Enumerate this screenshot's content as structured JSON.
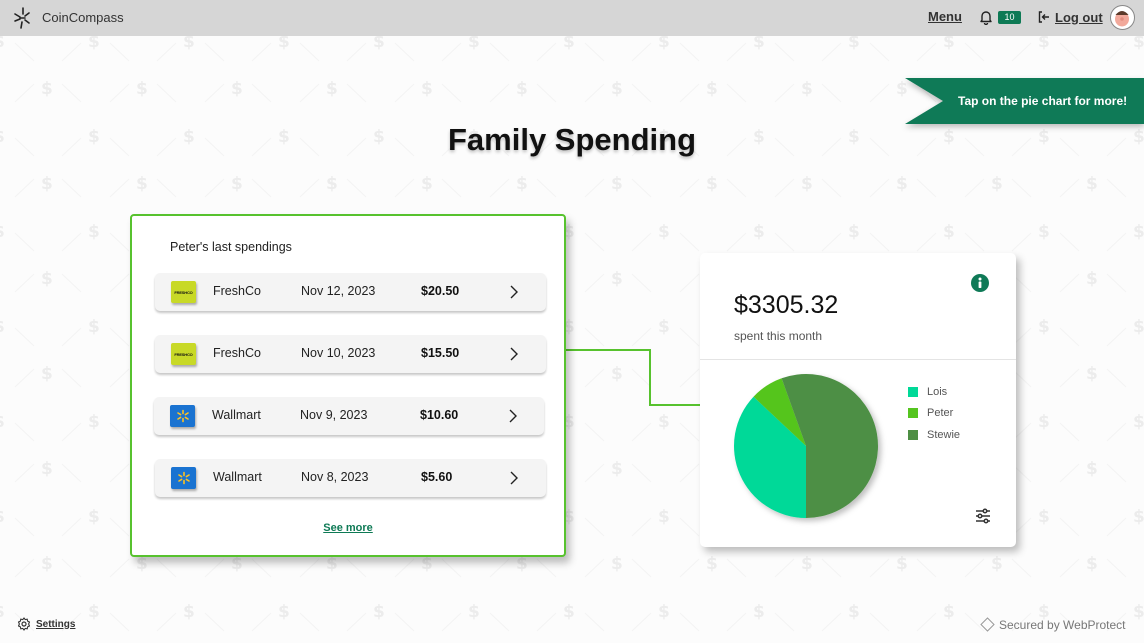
{
  "header": {
    "app_name": "CoinCompass",
    "menu_label": "Menu",
    "notification_count": "10",
    "logout_label": "Log out",
    "icons": {
      "logo": "compass-logo-icon",
      "bell": "bell-icon",
      "logout": "logout-icon",
      "avatar": "user-avatar"
    }
  },
  "banner": {
    "text": "Tap on the pie chart for more!",
    "color": "#0f7a57"
  },
  "page_title": "Family Spending",
  "spendings": {
    "title": "Peter's last spendings",
    "transactions": [
      {
        "merchant": "FreshCo",
        "logo": "FRESHCO",
        "logo_type": "freshco",
        "date": "Nov 12, 2023",
        "amount": "$20.50"
      },
      {
        "merchant": "FreshCo",
        "logo": "FRESHCO",
        "logo_type": "freshco",
        "date": "Nov 10, 2023",
        "amount": "$15.50"
      },
      {
        "merchant": "Wallmart",
        "logo": "",
        "logo_type": "walmart",
        "date": "Nov 9, 2023",
        "amount": "$10.60"
      },
      {
        "merchant": "Wallmart",
        "logo": "",
        "logo_type": "walmart",
        "date": "Nov 8, 2023",
        "amount": "$5.60"
      }
    ],
    "see_more_label": "See more",
    "border_color": "#57c22e"
  },
  "summary": {
    "total": "$3305.32",
    "subtitle": "spent this month",
    "icons": {
      "info": "info-icon",
      "filter": "sliders-icon"
    }
  },
  "chart_data": {
    "type": "pie",
    "title": "",
    "labels": [
      "Lois",
      "Peter",
      "Stewie"
    ],
    "values": [
      37,
      7.5,
      55.5
    ],
    "colors": [
      "#00d998",
      "#55c51f",
      "#4e8f44"
    ],
    "legend_position": "right"
  },
  "footer": {
    "settings_label": "Settings",
    "secured_label": "Secured by WebProtect"
  }
}
